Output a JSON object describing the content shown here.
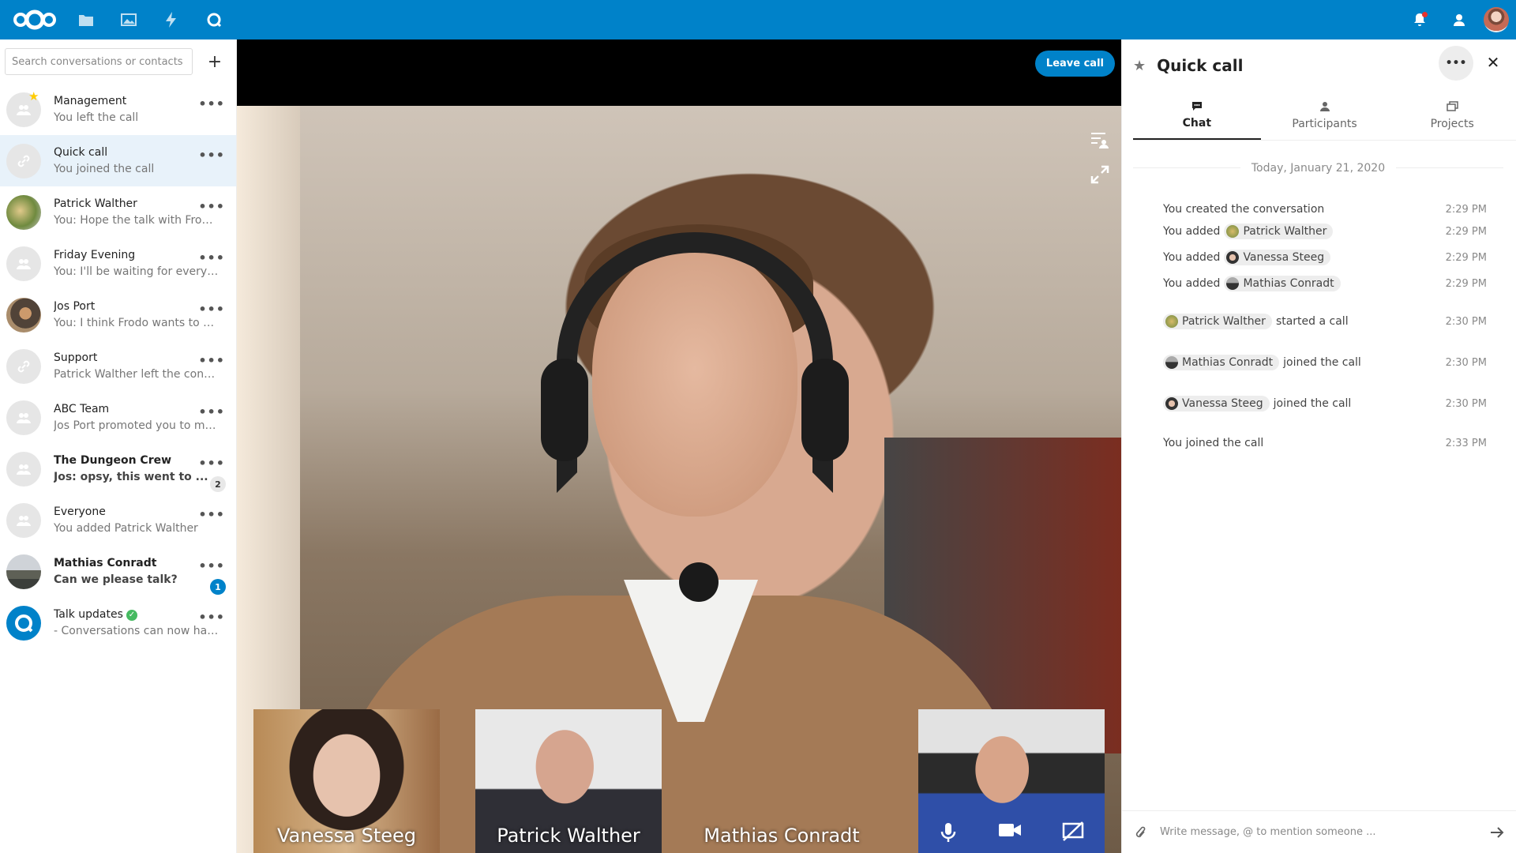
{
  "header": {
    "apps": [
      {
        "name": "files-icon"
      },
      {
        "name": "photos-icon"
      },
      {
        "name": "activity-icon"
      },
      {
        "name": "talk-icon"
      }
    ]
  },
  "sidebar": {
    "search_placeholder": "Search conversations or contacts",
    "add_label": "+",
    "more_label": "•••",
    "conversations": [
      {
        "name": "Management",
        "sub": "You left the call"
      },
      {
        "name": "Quick call",
        "sub": "You joined the call"
      },
      {
        "name": "Patrick Walther",
        "sub": "You: Hope the talk with Frodo ..."
      },
      {
        "name": "Friday Evening",
        "sub": "You: I'll be waiting for everyon..."
      },
      {
        "name": "Jos Port",
        "sub": "You: I think Frodo wants to dat..."
      },
      {
        "name": "Support",
        "sub": "Patrick Walther left the conver..."
      },
      {
        "name": "ABC Team",
        "sub": "Jos Port promoted you to mod..."
      },
      {
        "name": "The Dungeon Crew",
        "sub": "Jos: opsy, this went to ...",
        "unread": "2"
      },
      {
        "name": "Everyone",
        "sub": "You added Patrick Walther"
      },
      {
        "name": "Mathias Conradt",
        "sub": "Can we please talk?",
        "unread": "1"
      },
      {
        "name": "Talk updates",
        "sub": "- Conversations can now have..."
      }
    ]
  },
  "call": {
    "leave_label": "Leave call",
    "participants": [
      "Vanessa Steeg",
      "Patrick Walther",
      "Mathias Conradt"
    ]
  },
  "right_panel": {
    "title": "Quick call",
    "more_label": "•••",
    "close_label": "✕",
    "tabs": [
      {
        "label": "Chat"
      },
      {
        "label": "Participants"
      },
      {
        "label": "Projects"
      }
    ],
    "date_separator": "Today, January 21, 2020",
    "messages": [
      {
        "prefix": "You created the conversation",
        "time": "2:29 PM"
      },
      {
        "prefix": "You added",
        "mention": "Patrick Walther",
        "time": "2:29 PM"
      },
      {
        "prefix": "You added",
        "mention": "Vanessa Steeg",
        "time": "2:29 PM"
      },
      {
        "prefix": "You added",
        "mention": "Mathias Conradt",
        "time": "2:29 PM"
      },
      {
        "mention": "Patrick Walther",
        "suffix": "started a call",
        "time": "2:30 PM"
      },
      {
        "mention": "Mathias Conradt",
        "suffix": "joined the call",
        "time": "2:30 PM"
      },
      {
        "mention": "Vanessa Steeg",
        "suffix": "joined the call",
        "time": "2:30 PM"
      },
      {
        "prefix": "You joined the call",
        "time": "2:33 PM"
      }
    ],
    "composer_placeholder": "Write message, @ to mention someone ..."
  }
}
